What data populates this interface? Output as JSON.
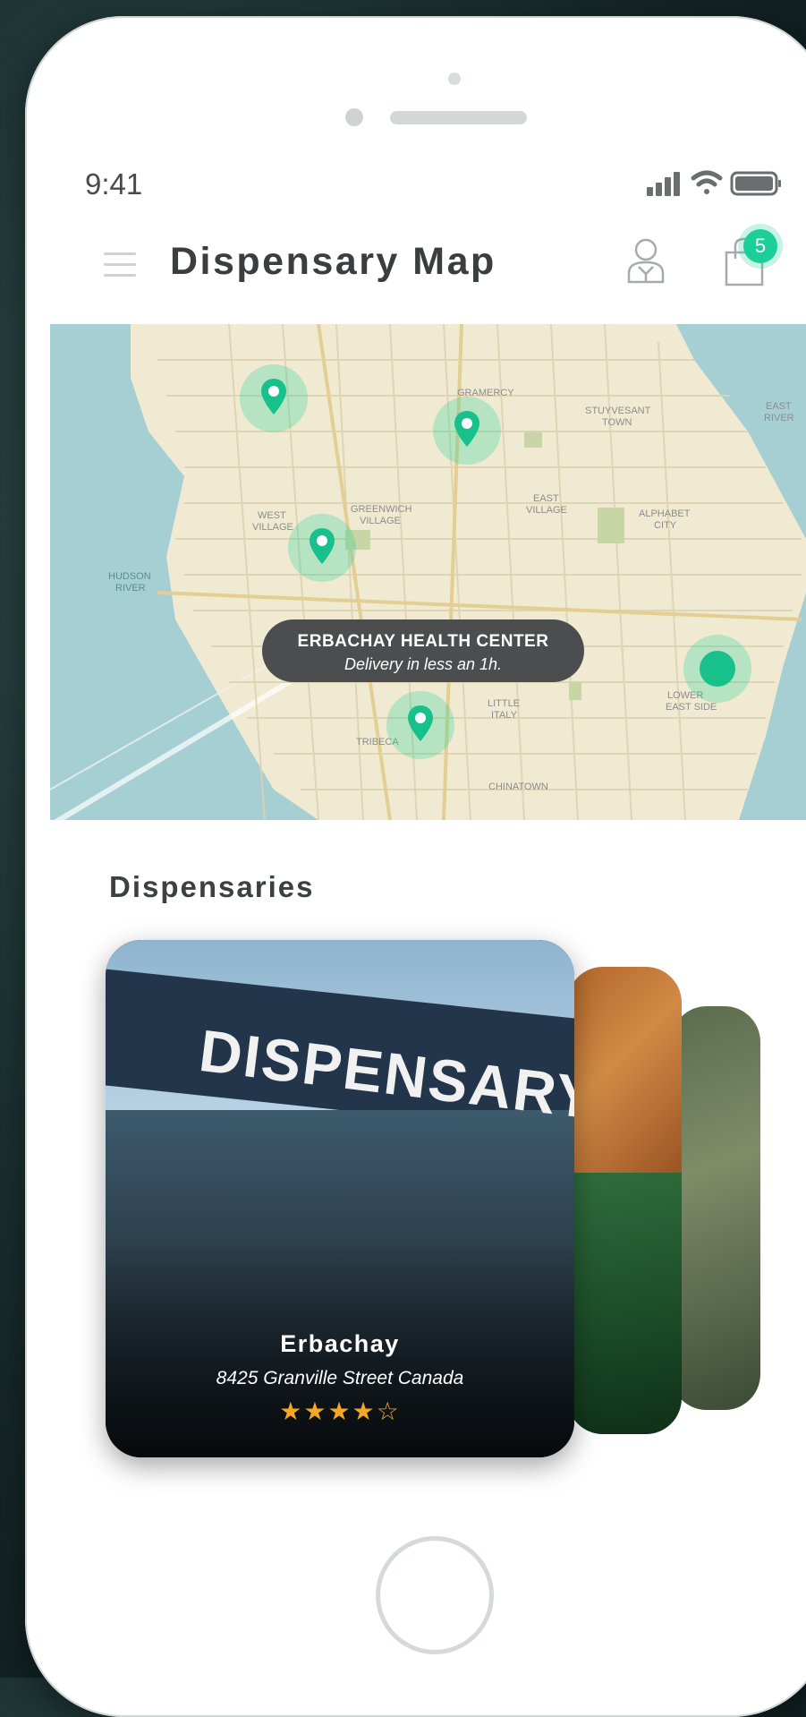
{
  "status_bar": {
    "time": "9:41"
  },
  "header": {
    "title": "Dispensary Map",
    "cart_count": "5"
  },
  "map": {
    "labels": {
      "gramercy": "GRAMERCY",
      "stuyvesant": "STUYVESANT\nTOWN",
      "east_river": "EAST\nRIVER",
      "west_village": "WEST\nVILLAGE",
      "greenwich_village": "GREENWICH\nVILLAGE",
      "east_village": "EAST\nVILLAGE",
      "alphabet_city": "ALPHABET\nCITY",
      "hudson_river": "HUDSON\nRIVER",
      "little_italy": "LITTLE\nITALY",
      "lower_east_side": "LOWER\nEAST SIDE",
      "tribeca": "TRIBECA",
      "chinatown": "CHINATOWN"
    },
    "callout": {
      "title": "ERBACHAY HEALTH CENTER",
      "subtitle": "Delivery in less an 1h."
    },
    "pin_color": "#1ccf98"
  },
  "section": {
    "title": "Dispensaries"
  },
  "cards": [
    {
      "name": "Erbachay",
      "address": "8425 Granville Street Canada",
      "sign": "DISPENSARY",
      "rating": 4,
      "rating_max": 5,
      "stars": "★★★★☆"
    }
  ],
  "colors": {
    "accent": "#1ccf98",
    "title": "#3b3d40"
  }
}
